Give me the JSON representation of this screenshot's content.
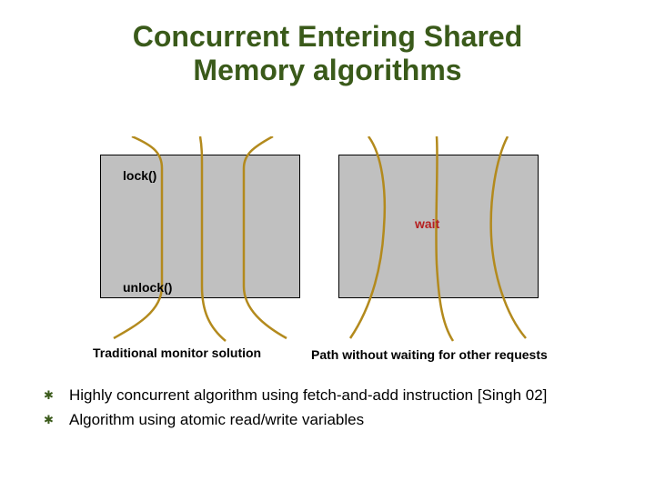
{
  "title_line1": "Concurrent Entering Shared",
  "title_line2": "Memory algorithms",
  "diagram": {
    "lock_label": "lock()",
    "unlock_label": "unlock()",
    "wait_label": "wait",
    "caption_left": "Traditional monitor solution",
    "caption_right": "Path without waiting for other requests"
  },
  "bullets": [
    "Highly concurrent algorithm using fetch-and-add instruction [Singh 02]",
    "Algorithm using atomic read/write variables"
  ],
  "colors": {
    "heading": "#3a5a1a",
    "box_fill": "#c0c0c0",
    "curve": "#b38a1d",
    "wait_text": "#b52020"
  }
}
